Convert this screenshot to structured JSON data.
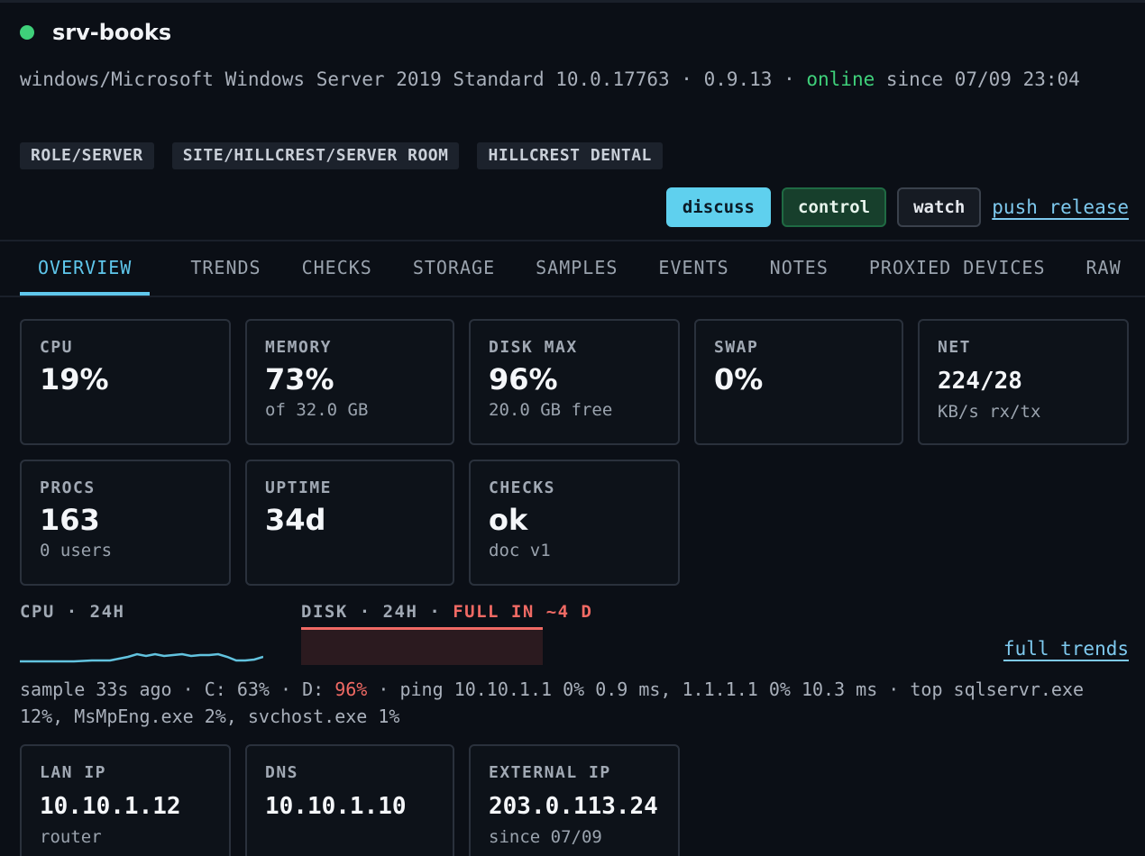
{
  "host": {
    "name": "srv-books",
    "status_color": "#3fd07a",
    "os_line_a": "windows/Microsoft Windows Server 2019 Standard 10.0.17763 · 0.9.13 · ",
    "online_word": "online",
    "os_line_b": " since 07/09 23:04"
  },
  "tags": [
    "ROLE/SERVER",
    "SITE/HILLCREST/SERVER ROOM",
    "HILLCREST DENTAL"
  ],
  "actions": {
    "discuss": "discuss",
    "control": "control",
    "watch": "watch",
    "push_release": "push release"
  },
  "tabs": [
    "OVERVIEW",
    "TRENDS",
    "CHECKS",
    "STORAGE",
    "SAMPLES",
    "EVENTS",
    "NOTES",
    "PROXIED DEVICES",
    "RAW"
  ],
  "active_tab": "OVERVIEW",
  "metrics": {
    "cpu": {
      "label": "CPU",
      "value": "19%"
    },
    "memory": {
      "label": "MEMORY",
      "value": "73%",
      "sub": "of 32.0 GB"
    },
    "disk": {
      "label": "DISK MAX",
      "value": "96%",
      "sub": "20.0 GB free"
    },
    "swap": {
      "label": "SWAP",
      "value": "0%"
    },
    "net": {
      "label": "NET",
      "value": "224/28",
      "sub": "KB/s rx/tx"
    },
    "procs": {
      "label": "PROCS",
      "value": "163",
      "sub": "0 users"
    },
    "uptime": {
      "label": "UPTIME",
      "value": "34d"
    },
    "checks": {
      "label": "CHECKS",
      "value": "ok",
      "sub": "doc v1"
    }
  },
  "sparklines": {
    "cpu_label": "CPU · 24H",
    "disk_label_a": "DISK · 24H · ",
    "disk_warn": "FULL IN ~4 D",
    "full_trends": "full trends"
  },
  "sample": {
    "a": "sample 33s ago · C: 63% · D: ",
    "d_pct": "96%",
    "b": " · ping 10.10.1.1 0% 0.9 ms, 1.1.1.1 0% 10.3 ms · top sqlservr.exe 12%, MsMpEng.exe 2%, svchost.exe 1%"
  },
  "network": {
    "lan": {
      "label": "LAN IP",
      "value": "10.10.1.12",
      "sub": "router"
    },
    "dns": {
      "label": "DNS",
      "value": "10.10.1.10"
    },
    "external": {
      "label": "EXTERNAL IP",
      "value": "203.0.113.24",
      "sub": "since 07/09"
    }
  },
  "colors": {
    "accent": "#5fc7ec",
    "ok": "#3fd07a",
    "warn": "#f06a64"
  }
}
